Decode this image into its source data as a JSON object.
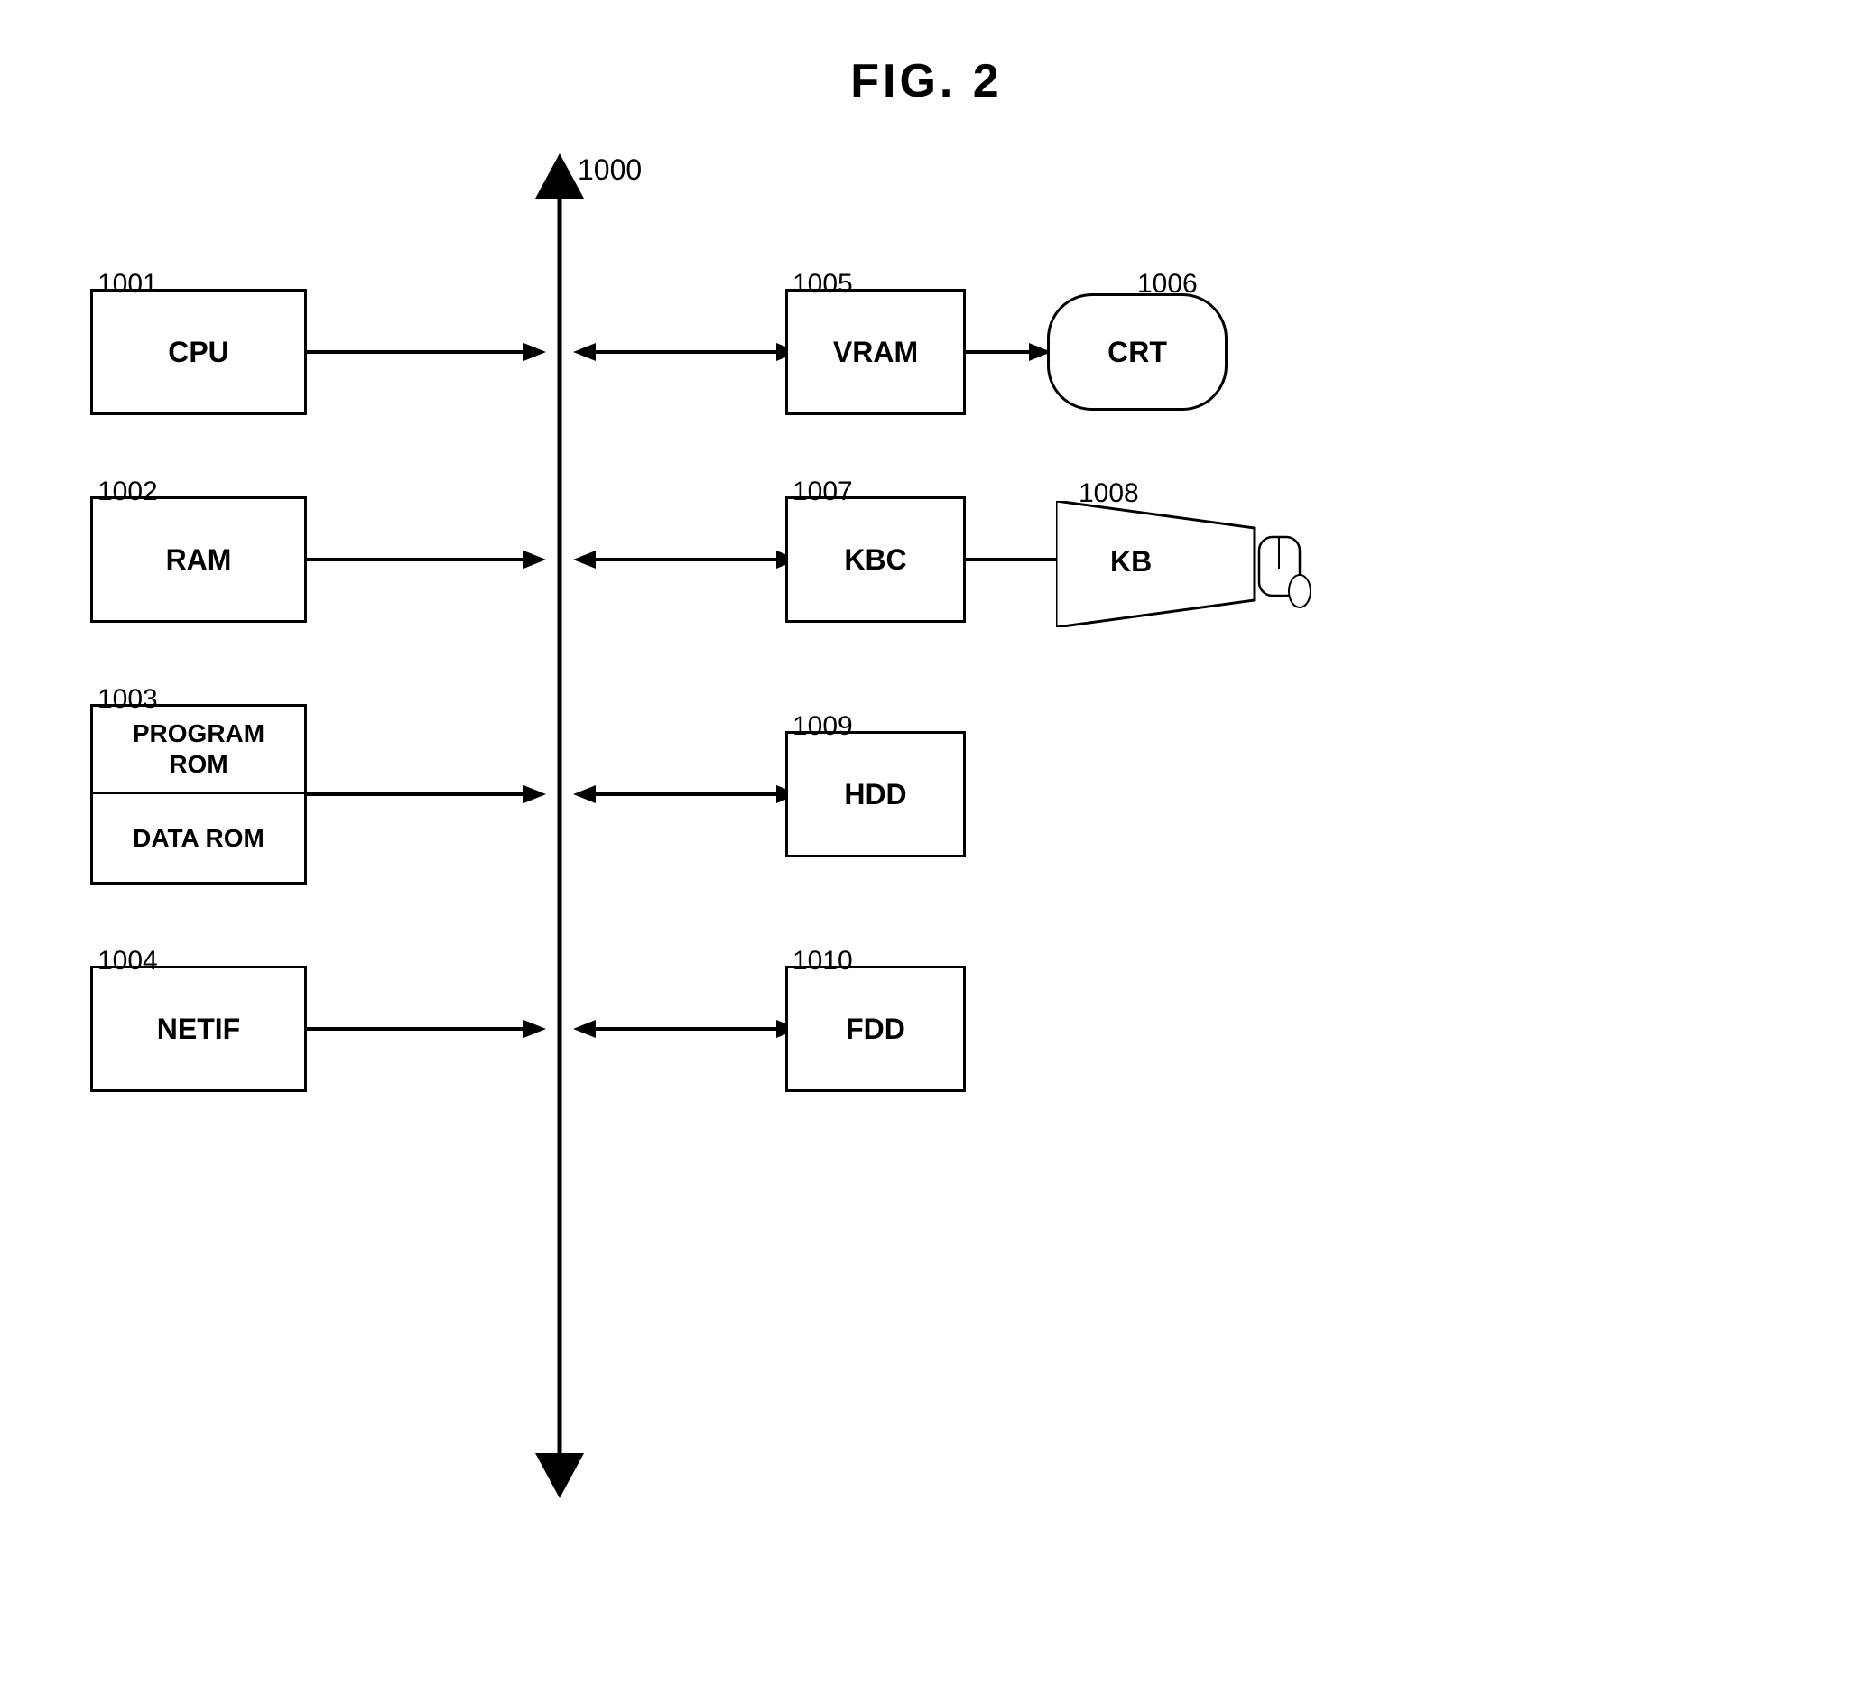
{
  "title": "FIG. 2",
  "bus_label": "1000",
  "components": [
    {
      "id": "cpu",
      "label": "CPU",
      "ref": "1001"
    },
    {
      "id": "ram",
      "label": "RAM",
      "ref": "1002"
    },
    {
      "id": "rom",
      "label": "PROGRAM\nROM\nDATA ROM",
      "ref": "1003"
    },
    {
      "id": "netif",
      "label": "NETIF",
      "ref": "1004"
    },
    {
      "id": "vram",
      "label": "VRAM",
      "ref": "1005"
    },
    {
      "id": "crt",
      "label": "CRT",
      "ref": "1006"
    },
    {
      "id": "kbc",
      "label": "KBC",
      "ref": "1007"
    },
    {
      "id": "kb",
      "label": "KB",
      "ref": "1008"
    },
    {
      "id": "hdd",
      "label": "HDD",
      "ref": "1009"
    },
    {
      "id": "fdd",
      "label": "FDD",
      "ref": "1010"
    }
  ]
}
